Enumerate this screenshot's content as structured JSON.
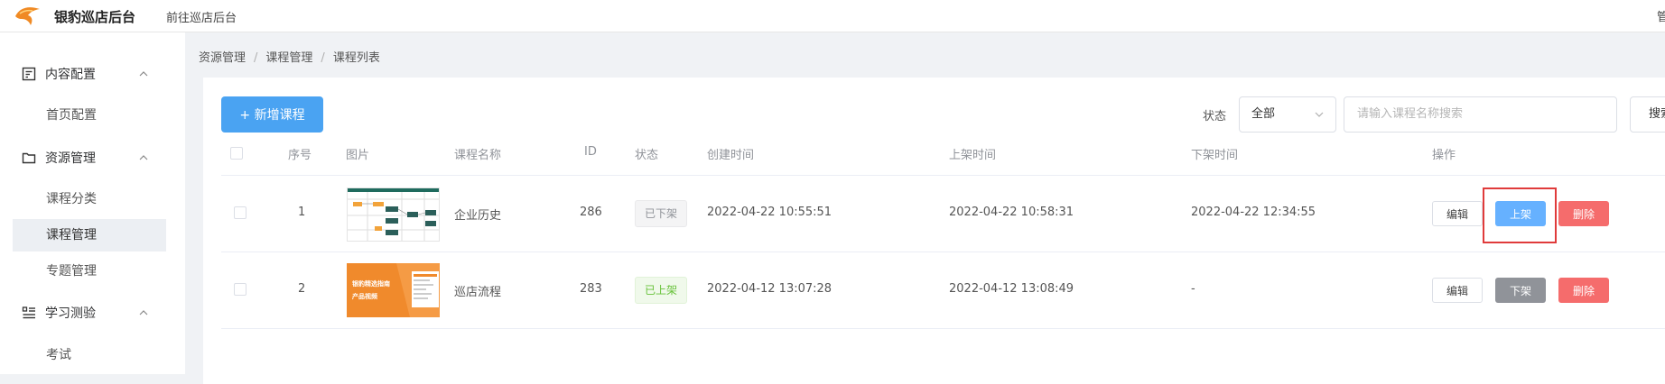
{
  "header": {
    "brand": "银豹巡店后台",
    "nav_link": "前往巡店后台",
    "right_text": "管"
  },
  "sidebar": {
    "groups": [
      {
        "label": "内容配置",
        "icon": "document-icon",
        "items": [
          {
            "label": "首页配置"
          }
        ]
      },
      {
        "label": "资源管理",
        "icon": "folder-icon",
        "items": [
          {
            "label": "课程分类"
          },
          {
            "label": "课程管理",
            "active": true
          },
          {
            "label": "专题管理"
          }
        ]
      },
      {
        "label": "学习测验",
        "icon": "list-icon",
        "items": [
          {
            "label": "考试"
          }
        ]
      }
    ]
  },
  "breadcrumb": [
    "资源管理",
    "课程管理",
    "课程列表"
  ],
  "toolbar": {
    "add_label": "+ 新增课程",
    "status_label": "状态",
    "status_value": "全部",
    "search_placeholder": "请输入课程名称搜索",
    "search_button": "搜索"
  },
  "table": {
    "headers": [
      "序号",
      "图片",
      "课程名称",
      "ID",
      "状态",
      "创建时间",
      "上架时间",
      "下架时间",
      "操作"
    ],
    "rows": [
      {
        "index": "1",
        "name": "企业历史",
        "id": "286",
        "status": "已下架",
        "created": "2022-04-22 10:55:51",
        "listed": "2022-04-22 10:58:31",
        "delisted": "2022-04-22 12:34:55",
        "thumb_icon": "flowchart-thumbnail",
        "actions": {
          "edit": "编辑",
          "toggle": "上架",
          "delete": "删除"
        }
      },
      {
        "index": "2",
        "name": "巡店流程",
        "id": "283",
        "status": "已上架",
        "created": "2022-04-12 13:07:28",
        "listed": "2022-04-12 13:08:49",
        "delisted": "-",
        "thumb_icon": "orange-banner-thumbnail",
        "thumb_text": [
          "银豹精选指南",
          "产品视频"
        ],
        "actions": {
          "edit": "编辑",
          "toggle": "下架",
          "delete": "删除"
        }
      }
    ]
  },
  "colors": {
    "primary": "#4aa3f2",
    "danger": "#f56c6c",
    "highlight_box": "#e03b3b"
  }
}
